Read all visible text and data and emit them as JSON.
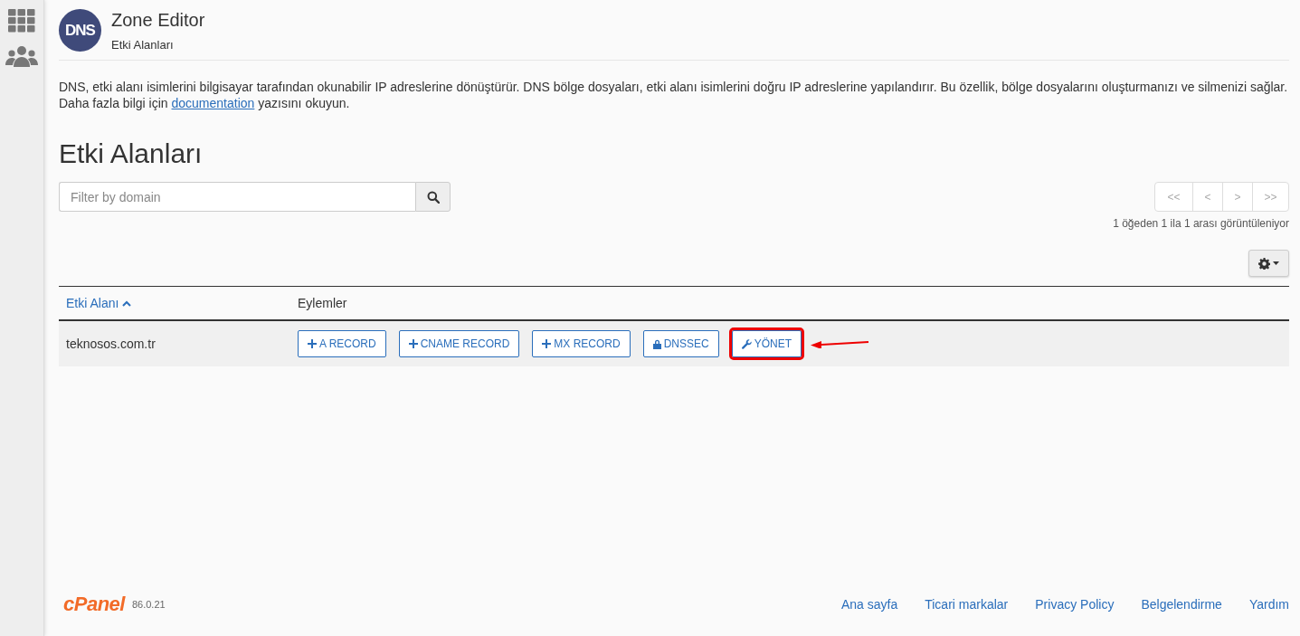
{
  "header": {
    "logo": "DNS",
    "title": "Zone Editor",
    "subtitle": "Etki Alanları"
  },
  "description": {
    "before": "DNS, etki alanı isimlerini bilgisayar tarafından okunabilir IP adreslerine dönüştürür. DNS bölge dosyaları, etki alanı isimlerini doğru IP adreslerine yapılandırır. Bu özellik, bölge dosyalarını oluşturmanızı ve silmenizi sağlar. Daha fazla bilgi için ",
    "link": "documentation",
    "after": " yazısını okuyun."
  },
  "heading": "Etki Alanları",
  "filter": {
    "placeholder": "Filter by domain"
  },
  "pagination": {
    "buttons": [
      {
        "label": "<<",
        "disabled": true
      },
      {
        "label": "<",
        "disabled": true
      },
      {
        "label": ">",
        "disabled": true
      },
      {
        "label": ">>",
        "disabled": true
      }
    ],
    "range_text": "1 öğeden 1 ila 1 arası görüntüleniyor"
  },
  "table": {
    "columns": [
      {
        "label": "Etki Alanı",
        "sorted": true
      },
      {
        "label": "Eylemler",
        "sorted": false
      }
    ],
    "rows": [
      {
        "domain": "teknosos.com.tr",
        "actions": [
          {
            "label": "A RECORD",
            "kind": "add",
            "highlighted": false
          },
          {
            "label": "CNAME RECORD",
            "kind": "add",
            "highlighted": false
          },
          {
            "label": "MX RECORD",
            "kind": "add",
            "highlighted": false
          },
          {
            "label": "DNSSEC",
            "kind": "security",
            "highlighted": false
          },
          {
            "label": "YÖNET",
            "kind": "manage",
            "highlighted": true
          }
        ]
      }
    ]
  },
  "footer": {
    "logo": "cPanel",
    "version": "86.0.21",
    "links": [
      "Ana sayfa",
      "Ticari markalar",
      "Privacy Policy",
      "Belgelendirme",
      "Yardım"
    ]
  }
}
